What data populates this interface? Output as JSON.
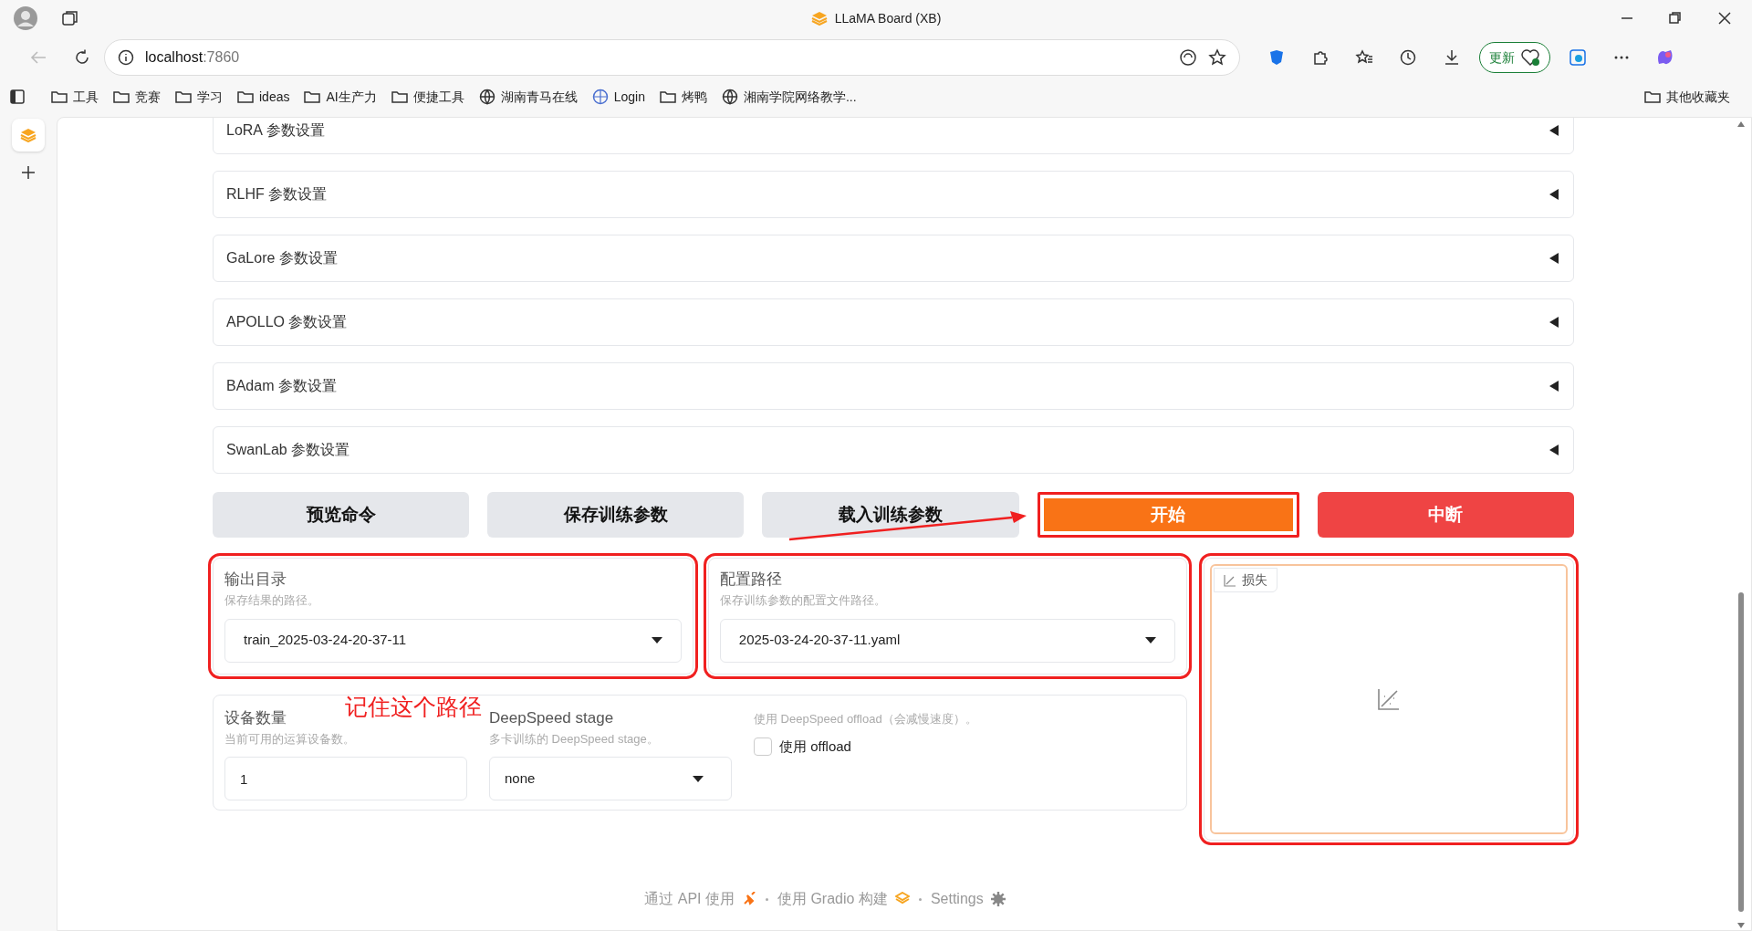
{
  "browser": {
    "title": "LLaMA Board (XB)",
    "url_host": "localhost",
    "url_port": ":7860",
    "update_label": "更新",
    "bookmarks": [
      {
        "label": "工具",
        "kind": "folder"
      },
      {
        "label": "竞赛",
        "kind": "folder"
      },
      {
        "label": "学习",
        "kind": "folder"
      },
      {
        "label": "ideas",
        "kind": "folder"
      },
      {
        "label": "AI生产力",
        "kind": "folder"
      },
      {
        "label": "便捷工具",
        "kind": "folder"
      },
      {
        "label": "湖南青马在线",
        "kind": "globe"
      },
      {
        "label": "Login",
        "kind": "site"
      },
      {
        "label": "烤鸭",
        "kind": "folder"
      },
      {
        "label": "湘南学院网络教学...",
        "kind": "globe"
      }
    ],
    "other_bookmarks": "其他收藏夹"
  },
  "accordions": [
    {
      "label": "LoRA 参数设置",
      "expanded": false
    },
    {
      "label": "RLHF 参数设置",
      "expanded": false
    },
    {
      "label": "GaLore 参数设置",
      "expanded": false
    },
    {
      "label": "APOLLO 参数设置",
      "expanded": false
    },
    {
      "label": "BAdam 参数设置",
      "expanded": false
    },
    {
      "label": "SwanLab 参数设置",
      "expanded": false
    }
  ],
  "buttons": [
    {
      "label": "预览命令",
      "kind": "secondary",
      "highlighted": false
    },
    {
      "label": "保存训练参数",
      "kind": "secondary",
      "highlighted": false
    },
    {
      "label": "载入训练参数",
      "kind": "secondary",
      "highlighted": false
    },
    {
      "label": "开始",
      "kind": "primary",
      "highlighted": true
    },
    {
      "label": "中断",
      "kind": "stop",
      "highlighted": false
    }
  ],
  "output_dir": {
    "label": "输出目录",
    "info": "保存结果的路径。",
    "value": "train_2025-03-24-20-37-11",
    "highlighted": true
  },
  "config_path": {
    "label": "配置路径",
    "info": "保存训练参数的配置文件路径。",
    "value": "2025-03-24-20-37-11.yaml",
    "highlighted": true
  },
  "loss_plot": {
    "label": "损失",
    "highlighted": true
  },
  "device_count": {
    "label": "设备数量",
    "info": "当前可用的运算设备数。",
    "value": "1"
  },
  "ds_stage": {
    "label": "DeepSpeed stage",
    "info": "多卡训练的 DeepSpeed stage。",
    "value": "none"
  },
  "ds_offload": {
    "info": "使用 DeepSpeed offload（会减慢速度）。",
    "label": "使用 offload",
    "checked": false
  },
  "annotation": {
    "note": "记住这个路径"
  },
  "footer": [
    {
      "label": "通过 API 使用",
      "kind": "api"
    },
    {
      "label": "使用 Gradio 构建",
      "kind": "gradio"
    },
    {
      "label": "Settings",
      "kind": "settings"
    }
  ]
}
